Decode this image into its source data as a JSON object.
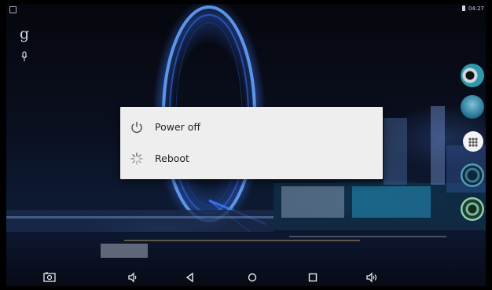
{
  "status_bar": {
    "time": "04:27"
  },
  "power_menu": {
    "items": [
      {
        "label": "Power off",
        "icon": "power-icon"
      },
      {
        "label": "Reboot",
        "icon": "reboot-icon"
      }
    ]
  },
  "launcher": {
    "search_logo_text": "g",
    "mic_icon": "mic-icon"
  },
  "dock": {
    "items": [
      "app-circle-1",
      "app-circle-2",
      "app-drawer-icon",
      "speaker-icon",
      "settings-ring-icon"
    ]
  },
  "nav_bar": {
    "items": [
      "screenshot-icon",
      "volume-down-icon",
      "back-icon",
      "home-icon",
      "recents-icon",
      "volume-up-icon"
    ]
  },
  "colors": {
    "dialog_bg": "#eeeeee",
    "dialog_text": "#222222",
    "icon_gray": "#555555"
  }
}
